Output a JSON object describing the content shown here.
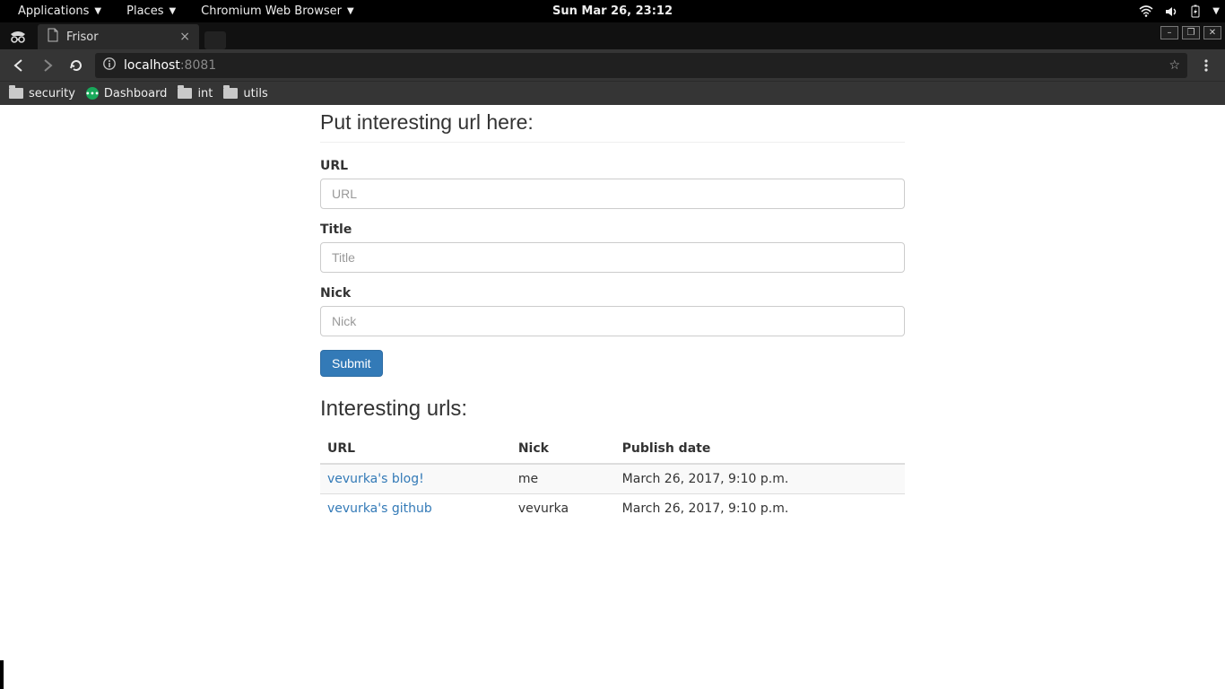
{
  "sysbar": {
    "apps": "Applications",
    "places": "Places",
    "appname": "Chromium Web Browser",
    "clock": "Sun Mar 26, 23:12"
  },
  "tab": {
    "title": "Frisor"
  },
  "urlbar": {
    "host": "localhost",
    "port": ":8081"
  },
  "bookmarks": {
    "security": "security",
    "dashboard": "Dashboard",
    "int": "int",
    "utils": "utils"
  },
  "page": {
    "form_heading": "Put interesting url here:",
    "url_label": "URL",
    "url_placeholder": "URL",
    "title_label": "Title",
    "title_placeholder": "Title",
    "nick_label": "Nick",
    "nick_placeholder": "Nick",
    "submit": "Submit",
    "list_heading": "Interesting urls:",
    "col_url": "URL",
    "col_nick": "Nick",
    "col_date": "Publish date",
    "rows": [
      {
        "title": "vevurka's blog!",
        "nick": "me",
        "date": "March 26, 2017, 9:10 p.m."
      },
      {
        "title": "vevurka's github",
        "nick": "vevurka",
        "date": "March 26, 2017, 9:10 p.m."
      }
    ]
  }
}
